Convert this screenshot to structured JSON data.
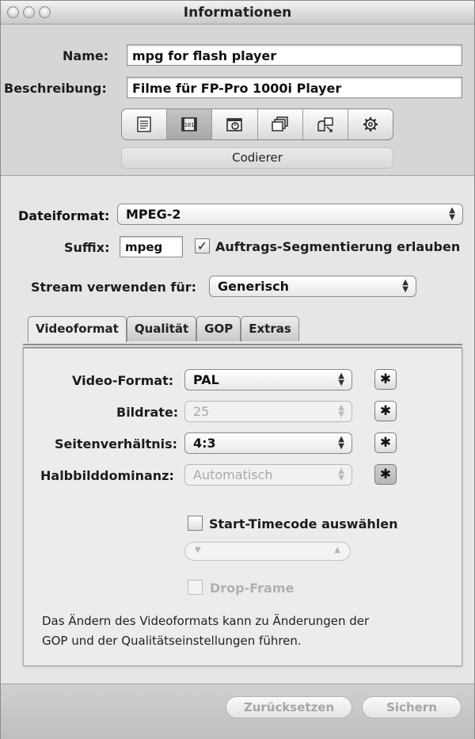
{
  "window": {
    "title": "Informationen"
  },
  "preset": {
    "name_label": "Name:",
    "name_value": "mpg for flash player",
    "description_label": "Beschreibung:",
    "description_value": "Filme für FP-Pro 1000i Player"
  },
  "toolbar": {
    "buttons": [
      {
        "icon": "summary-icon"
      },
      {
        "icon": "encoder-icon",
        "active": true
      },
      {
        "icon": "frame-controls-icon"
      },
      {
        "icon": "filters-icon"
      },
      {
        "icon": "geometry-icon"
      },
      {
        "icon": "actions-icon"
      }
    ],
    "section_label": "Codierer"
  },
  "encoder": {
    "file_format_label": "Dateiformat:",
    "file_format_value": "MPEG-2",
    "suffix_label": "Suffix:",
    "suffix_value": "mpeg",
    "segmentation_label": "Auftrags-Segmentierung erlauben",
    "segmentation_checked": true,
    "stream_label": "Stream verwenden für:",
    "stream_value": "Generisch"
  },
  "tabs": [
    "Videoformat",
    "Qualität",
    "GOP",
    "Extras"
  ],
  "video": {
    "video_format_label": "Video-Format:",
    "video_format_value": "PAL",
    "frame_rate_label": "Bildrate:",
    "frame_rate_value": "25",
    "aspect_label": "Seitenverhältnis:",
    "aspect_value": "4:3",
    "field_dominance_label": "Halbbilddominanz:",
    "field_dominance_value": "Automatisch",
    "start_timecode_label": "Start-Timecode auswählen",
    "start_timecode_checked": false,
    "drop_frame_label": "Drop-Frame",
    "drop_frame_checked": false,
    "note_line1": "Das Ändern des Videoformats kann zu Änderungen der",
    "note_line2": "GOP und der Qualitätseinstellungen führen."
  },
  "footer": {
    "reset_label": "Zurücksetzen",
    "save_label": "Sichern"
  }
}
